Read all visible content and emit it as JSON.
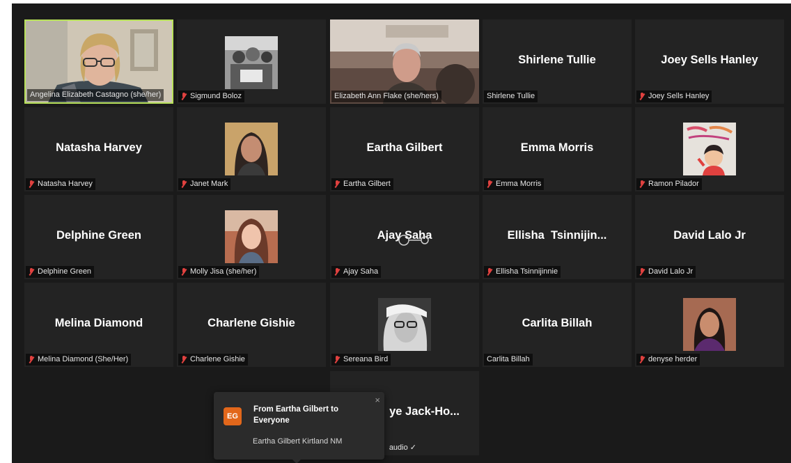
{
  "participants": {
    "angelina": {
      "label": "Angelina Elizabeth Castagno (she/her)"
    },
    "sigmund": {
      "label": "Sigmund Boloz"
    },
    "elizabeth": {
      "label": "Elizabeth Ann Flake (she/hers)"
    },
    "shirlene": {
      "name": "Shirlene Tullie",
      "label": "Shirlene Tullie"
    },
    "joey": {
      "name": "Joey Sells Hanley",
      "label": "Joey Sells Hanley"
    },
    "natasha": {
      "name": "Natasha Harvey",
      "label": "Natasha Harvey"
    },
    "janet": {
      "label": "Janet Mark"
    },
    "eartha": {
      "name": "Eartha Gilbert",
      "label": "Eartha Gilbert"
    },
    "emma": {
      "name": "Emma Morris",
      "label": "Emma Morris"
    },
    "ramon": {
      "label": "Ramon Pilador"
    },
    "delphine": {
      "name": "Delphine Green",
      "label": "Delphine Green"
    },
    "molly": {
      "label": "Molly Jisa (she/her)"
    },
    "ajay": {
      "name": "Ajay Saha",
      "label": "Ajay Saha"
    },
    "ellisha": {
      "name": "Ellisha  Tsinnijin...",
      "label": "Ellisha Tsinnijinnie"
    },
    "david": {
      "name": "David Lalo Jr",
      "label": "David Lalo Jr"
    },
    "melina": {
      "name": "Melina Diamond",
      "label": "Melina Diamond (She/Her)"
    },
    "charlene": {
      "name": "Charlene Gishie",
      "label": "Charlene Gishie"
    },
    "sereana": {
      "label": "Sereana Bird"
    },
    "carlita": {
      "name": "Carlita Billah",
      "label": "Carlita Billah"
    },
    "denyse": {
      "label": "denyse herder"
    },
    "partial": {
      "name": "ye Jack-Ho...",
      "label": "audio ✓"
    }
  },
  "chat_toast": {
    "avatar_initials": "EG",
    "title": "From Eartha Gilbert to Everyone",
    "message": "Eartha Gilbert Kirtland NM",
    "close_glyph": "×"
  },
  "colors": {
    "active_speaker_border": "#b9e25b",
    "muted_mic": "#e0413f",
    "avatar_bg": "#e2671b",
    "tile_bg": "#232323"
  }
}
